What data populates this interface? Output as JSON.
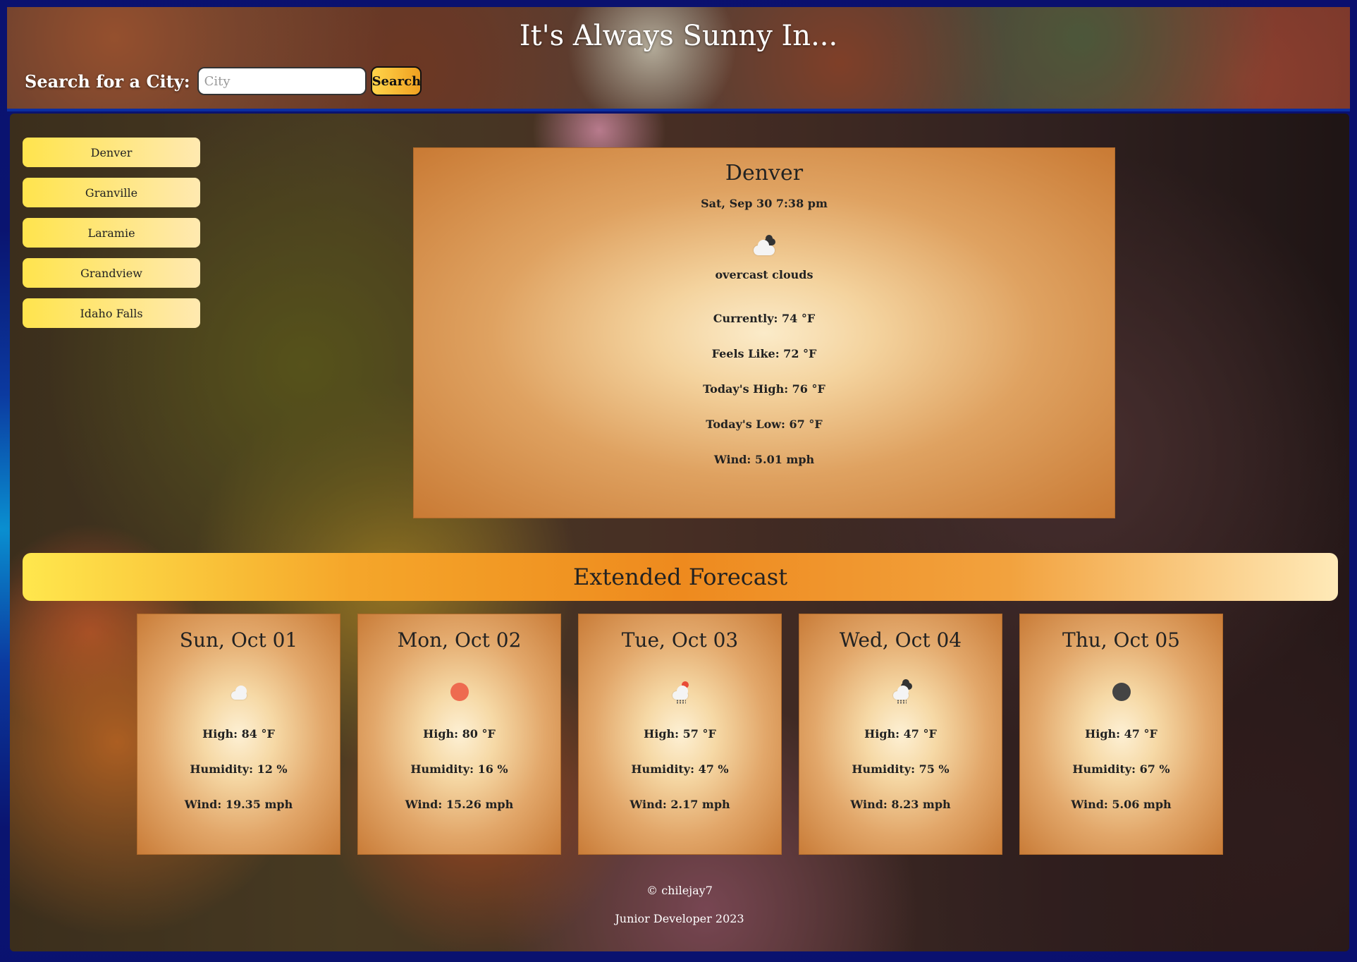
{
  "header": {
    "title": "It's Always Sunny In...",
    "search_label": "Search for a City:",
    "search_placeholder": "City",
    "search_value": "",
    "search_button": "Search"
  },
  "sidebar": {
    "cities": [
      "Denver",
      "Granville",
      "Laramie",
      "Grandview",
      "Idaho Falls"
    ]
  },
  "current": {
    "city": "Denver",
    "datetime": "Sat, Sep 30 7:38 pm",
    "icon": "overcast-clouds-icon",
    "description": "overcast clouds",
    "currently": "Currently: 74 °F",
    "feels_like": "Feels Like: 72 °F",
    "high": "Today's High: 76 °F",
    "low": "Today's Low: 67 °F",
    "wind": "Wind: 5.01 mph"
  },
  "extended": {
    "title": "Extended Forecast",
    "days": [
      {
        "date": "Sun, Oct 01",
        "icon": "cloud-icon",
        "high": "High: 84 °F",
        "humidity": "Humidity: 12 %",
        "wind": "Wind: 19.35 mph"
      },
      {
        "date": "Mon, Oct 02",
        "icon": "sun-icon",
        "high": "High: 80 °F",
        "humidity": "Humidity: 16 %",
        "wind": "Wind: 15.26 mph"
      },
      {
        "date": "Tue, Oct 03",
        "icon": "rain-sun-icon",
        "high": "High: 57 °F",
        "humidity": "Humidity: 47 %",
        "wind": "Wind: 2.17 mph"
      },
      {
        "date": "Wed, Oct 04",
        "icon": "rain-night-icon",
        "high": "High: 47 °F",
        "humidity": "Humidity: 75 %",
        "wind": "Wind: 8.23 mph"
      },
      {
        "date": "Thu, Oct 05",
        "icon": "moon-icon",
        "high": "High: 47 °F",
        "humidity": "Humidity: 67 %",
        "wind": "Wind: 5.06 mph"
      }
    ]
  },
  "footer": {
    "copyright": "© chilejay7",
    "tagline": "Junior Developer 2023"
  }
}
